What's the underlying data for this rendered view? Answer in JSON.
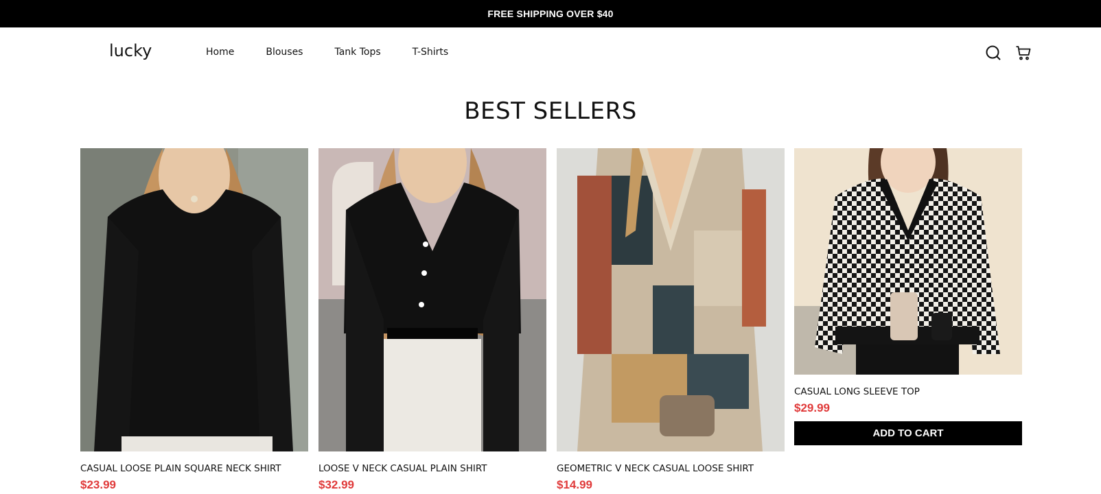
{
  "announcement": "FREE SHIPPING OVER $40",
  "header": {
    "logo": "lucky",
    "nav": [
      "Home",
      "Blouses",
      "Tank Tops",
      "T-Shirts"
    ],
    "icons": [
      "search-icon",
      "cart-icon"
    ]
  },
  "section": {
    "title": "BEST SELLERS"
  },
  "products": [
    {
      "title": "CASUAL LOOSE PLAIN SQUARE NECK SHIRT",
      "price": "$23.99",
      "image": "woman in black ribbed square-neck long sleeve top"
    },
    {
      "title": "LOOSE V NECK CASUAL PLAIN SHIRT",
      "price": "$32.99",
      "image": "woman in black v-neck blouse with lace sleeves"
    },
    {
      "title": "GEOMETRIC V NECK CASUAL LOOSE SHIRT",
      "price": "$14.99",
      "image": "woman in geometric patchwork v-neck top"
    },
    {
      "title": "CASUAL LONG SLEEVE TOP",
      "price": "$29.99",
      "image": "woman in black and white houndstooth v-neck sweater",
      "button": "ADD TO CART"
    }
  ],
  "colors": {
    "price": "#e03a3a",
    "announcement_bg": "#000000",
    "button_bg": "#000000"
  }
}
